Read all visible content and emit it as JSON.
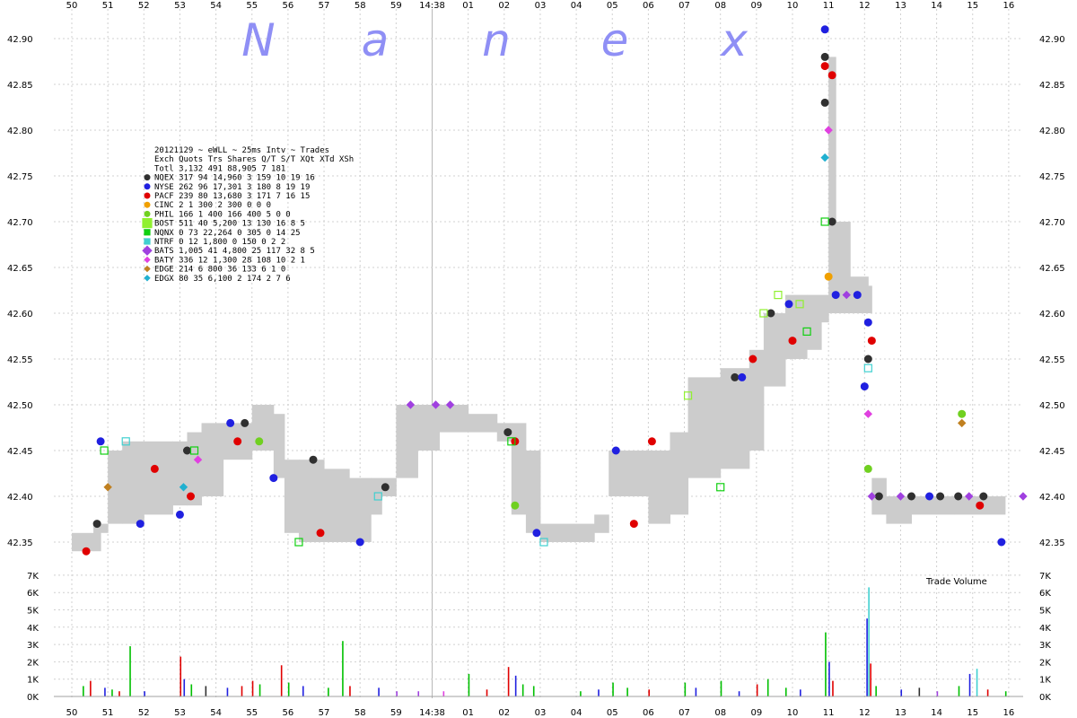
{
  "watermark": [
    "N",
    "a",
    "n",
    "e",
    "x"
  ],
  "legend": {
    "title": "20121129 ~ eWLL ~ 25ms Intv ~ Trades",
    "header": "Exch Quots Trs Shares  Q/T   S/T  XQt XTd XSh",
    "rows": [
      {
        "text": "Totl 3,132 491 88,905    7   181",
        "marker": "",
        "color": ""
      },
      {
        "text": "NQEX   317  94 14,960    3   159  10  19  16",
        "marker": "circle",
        "color": "#303030"
      },
      {
        "text": "NYSE   262  96 17,301    3   180   8  19  19",
        "marker": "circle",
        "color": "#2020e0"
      },
      {
        "text": "PACF   239  80 13,680    3   171   7  16  15",
        "marker": "circle",
        "color": "#e00000"
      },
      {
        "text": "CINC     2   1    300    2   300   0   0   0",
        "marker": "circle",
        "color": "#f0a000"
      },
      {
        "text": "PHIL   166   1    400  166   400   5   0   0",
        "marker": "circle",
        "color": "#70d020"
      },
      {
        "text": "BOST   511  40  5,200   13   130  16   8   5",
        "marker": "square",
        "color": "#90f030"
      },
      {
        "text": "NQNX     0  73 22,264    0   305   0  14  25",
        "marker": "square",
        "color": "#10d010"
      },
      {
        "text": "NTRF     0  12  1,800    0   150   0   2   2",
        "marker": "square",
        "color": "#40d0d0"
      },
      {
        "text": "BATS 1,005  41  4,800   25   117  32   8   5",
        "marker": "diamond",
        "color": "#a040e0"
      },
      {
        "text": "BATY   336  12  1,300   28   108  10   2   1",
        "marker": "diamond",
        "color": "#e040e0"
      },
      {
        "text": "EDGE   214   6    800   36   133   6   1   0",
        "marker": "diamond",
        "color": "#c08020"
      },
      {
        "text": "EDGX    80  35  6,100    2   174   2   7   6",
        "marker": "diamond",
        "color": "#20b0d0"
      }
    ]
  },
  "chart_data": {
    "type": "scatter",
    "x_ticks": [
      "50",
      "51",
      "52",
      "53",
      "54",
      "55",
      "56",
      "57",
      "58",
      "59",
      "14:38",
      "01",
      "02",
      "03",
      "04",
      "05",
      "06",
      "07",
      "08",
      "09",
      "10",
      "11",
      "12",
      "13",
      "14",
      "15",
      "16"
    ],
    "price_axis": {
      "ticks": [
        "42.90",
        "42.85",
        "42.80",
        "42.75",
        "42.70",
        "42.65",
        "42.60",
        "42.55",
        "42.50",
        "42.45",
        "42.40",
        "42.35"
      ],
      "range": [
        42.33,
        42.92
      ]
    },
    "volume_axis": {
      "ticks": [
        "7K",
        "6K",
        "5K",
        "4K",
        "3K",
        "2K",
        "1K",
        "0K"
      ],
      "range": [
        0,
        7000
      ],
      "label": "Trade Volume"
    },
    "nbbo_band": [
      [
        50.0,
        42.34,
        42.36
      ],
      [
        50.6,
        42.34,
        42.37
      ],
      [
        50.8,
        42.36,
        42.37
      ],
      [
        51.0,
        42.37,
        42.45
      ],
      [
        51.4,
        42.37,
        42.46
      ],
      [
        52.0,
        42.38,
        42.46
      ],
      [
        52.8,
        42.39,
        42.46
      ],
      [
        53.2,
        42.39,
        42.47
      ],
      [
        53.6,
        42.4,
        42.48
      ],
      [
        54.2,
        42.44,
        42.48
      ],
      [
        55.0,
        42.45,
        42.5
      ],
      [
        55.6,
        42.42,
        42.49
      ],
      [
        55.9,
        42.36,
        42.44
      ],
      [
        56.3,
        42.35,
        42.44
      ],
      [
        57.0,
        42.35,
        42.43
      ],
      [
        57.7,
        42.35,
        42.42
      ],
      [
        58.3,
        42.38,
        42.42
      ],
      [
        58.6,
        42.4,
        42.42
      ],
      [
        59.0,
        42.42,
        42.5
      ],
      [
        59.6,
        42.45,
        42.5
      ],
      [
        60.2,
        42.47,
        42.5
      ],
      [
        61.0,
        42.47,
        42.49
      ],
      [
        61.8,
        42.46,
        42.48
      ],
      [
        62.2,
        42.38,
        42.48
      ],
      [
        62.6,
        42.36,
        42.45
      ],
      [
        63.0,
        42.35,
        42.37
      ],
      [
        64.0,
        42.35,
        42.37
      ],
      [
        64.5,
        42.36,
        42.38
      ],
      [
        64.9,
        42.4,
        42.45
      ],
      [
        66.0,
        42.37,
        42.45
      ],
      [
        66.6,
        42.38,
        42.47
      ],
      [
        67.1,
        42.42,
        42.53
      ],
      [
        68.0,
        42.43,
        42.54
      ],
      [
        68.8,
        42.45,
        42.56
      ],
      [
        69.2,
        42.52,
        42.6
      ],
      [
        69.8,
        42.55,
        42.62
      ],
      [
        70.4,
        42.56,
        42.62
      ],
      [
        70.8,
        42.59,
        42.62
      ],
      [
        71.0,
        42.6,
        42.88
      ],
      [
        71.2,
        42.6,
        42.7
      ],
      [
        71.6,
        42.6,
        42.64
      ],
      [
        72.1,
        42.6,
        42.63
      ],
      [
        72.2,
        42.38,
        42.42
      ],
      [
        72.6,
        42.37,
        42.4
      ],
      [
        73.3,
        42.38,
        42.4
      ],
      [
        74.5,
        42.38,
        42.4
      ],
      [
        75.3,
        42.38,
        42.4
      ],
      [
        75.9,
        42.37,
        42.4
      ]
    ],
    "series": [
      {
        "name": "NQEX",
        "marker": "circle",
        "color": "#303030",
        "points": [
          [
            50.7,
            42.37
          ],
          [
            53.2,
            42.45
          ],
          [
            54.8,
            42.48
          ],
          [
            56.7,
            42.44
          ],
          [
            58.7,
            42.41
          ],
          [
            62.1,
            42.47
          ],
          [
            68.4,
            42.53
          ],
          [
            69.4,
            42.6
          ],
          [
            70.9,
            42.88
          ],
          [
            70.9,
            42.83
          ],
          [
            71.1,
            42.7
          ],
          [
            72.1,
            42.55
          ],
          [
            72.4,
            42.4
          ],
          [
            73.3,
            42.4
          ],
          [
            74.1,
            42.4
          ],
          [
            74.6,
            42.4
          ],
          [
            75.3,
            42.4
          ]
        ]
      },
      {
        "name": "NYSE",
        "marker": "circle",
        "color": "#2020e0",
        "points": [
          [
            50.8,
            42.46
          ],
          [
            51.9,
            42.37
          ],
          [
            53.0,
            42.38
          ],
          [
            54.4,
            42.48
          ],
          [
            55.6,
            42.42
          ],
          [
            58.0,
            42.35
          ],
          [
            62.9,
            42.36
          ],
          [
            65.1,
            42.45
          ],
          [
            68.6,
            42.53
          ],
          [
            69.9,
            42.61
          ],
          [
            70.9,
            42.91
          ],
          [
            71.2,
            42.62
          ],
          [
            71.8,
            42.62
          ],
          [
            72.1,
            42.59
          ],
          [
            72.0,
            42.52
          ],
          [
            73.8,
            42.4
          ],
          [
            75.8,
            42.35
          ]
        ]
      },
      {
        "name": "PACF",
        "marker": "circle",
        "color": "#e00000",
        "points": [
          [
            50.4,
            42.34
          ],
          [
            52.3,
            42.43
          ],
          [
            53.3,
            42.4
          ],
          [
            54.6,
            42.46
          ],
          [
            56.9,
            42.36
          ],
          [
            62.3,
            42.46
          ],
          [
            65.6,
            42.37
          ],
          [
            66.1,
            42.46
          ],
          [
            68.9,
            42.55
          ],
          [
            70.0,
            42.57
          ],
          [
            70.9,
            42.87
          ],
          [
            71.1,
            42.86
          ],
          [
            72.2,
            42.57
          ],
          [
            75.2,
            42.39
          ]
        ]
      },
      {
        "name": "CINC",
        "marker": "circle",
        "color": "#f0a000",
        "points": [
          [
            71.0,
            42.64
          ]
        ]
      },
      {
        "name": "PHIL",
        "marker": "circle",
        "color": "#70d020",
        "points": [
          [
            55.2,
            42.46
          ],
          [
            62.3,
            42.39
          ],
          [
            72.1,
            42.43
          ],
          [
            74.7,
            42.49
          ]
        ]
      },
      {
        "name": "BOST",
        "marker": "square",
        "color": "#90f030",
        "points": [
          [
            69.2,
            42.6
          ],
          [
            69.6,
            42.62
          ],
          [
            70.2,
            42.61
          ],
          [
            67.1,
            42.51
          ]
        ]
      },
      {
        "name": "NQNX",
        "marker": "square",
        "color": "#10d010",
        "points": [
          [
            50.9,
            42.45
          ],
          [
            53.4,
            42.45
          ],
          [
            56.3,
            42.35
          ],
          [
            62.2,
            42.46
          ],
          [
            68.0,
            42.41
          ],
          [
            70.4,
            42.58
          ],
          [
            70.9,
            42.7
          ]
        ]
      },
      {
        "name": "NTRF",
        "marker": "square",
        "color": "#40d0d0",
        "points": [
          [
            51.5,
            42.46
          ],
          [
            58.5,
            42.4
          ],
          [
            63.1,
            42.35
          ],
          [
            72.1,
            42.54
          ]
        ]
      },
      {
        "name": "BATS",
        "marker": "diamond",
        "color": "#a040e0",
        "points": [
          [
            59.4,
            42.5
          ],
          [
            60.1,
            42.5
          ],
          [
            60.5,
            42.5
          ],
          [
            71.5,
            42.62
          ],
          [
            72.2,
            42.4
          ],
          [
            73.0,
            42.4
          ],
          [
            74.9,
            42.4
          ],
          [
            76.4,
            42.4
          ]
        ]
      },
      {
        "name": "BATY",
        "marker": "diamond",
        "color": "#e040e0",
        "points": [
          [
            53.5,
            42.44
          ],
          [
            71.0,
            42.8
          ],
          [
            72.1,
            42.49
          ]
        ]
      },
      {
        "name": "EDGE",
        "marker": "diamond",
        "color": "#c08020",
        "points": [
          [
            51.0,
            42.41
          ],
          [
            74.7,
            42.48
          ]
        ]
      },
      {
        "name": "EDGX",
        "marker": "diamond",
        "color": "#20b0d0",
        "points": [
          [
            53.1,
            42.41
          ],
          [
            70.9,
            42.77
          ]
        ]
      }
    ],
    "volume_bars": [
      [
        50.3,
        600,
        "#00c000"
      ],
      [
        50.5,
        900,
        "#e00000"
      ],
      [
        50.9,
        500,
        "#2020e0"
      ],
      [
        51.1,
        400,
        "#00c000"
      ],
      [
        51.3,
        300,
        "#e00000"
      ],
      [
        51.6,
        2900,
        "#00c000"
      ],
      [
        52.0,
        300,
        "#2020e0"
      ],
      [
        53.0,
        2300,
        "#e00000"
      ],
      [
        53.1,
        1000,
        "#2020e0"
      ],
      [
        53.3,
        700,
        "#00c000"
      ],
      [
        53.7,
        600,
        "#303030"
      ],
      [
        54.3,
        500,
        "#2020e0"
      ],
      [
        54.7,
        600,
        "#e00000"
      ],
      [
        55.0,
        900,
        "#e00000"
      ],
      [
        55.2,
        700,
        "#00c000"
      ],
      [
        55.8,
        1800,
        "#e00000"
      ],
      [
        56.0,
        800,
        "#00c000"
      ],
      [
        56.4,
        600,
        "#2020e0"
      ],
      [
        57.1,
        500,
        "#00c000"
      ],
      [
        57.5,
        3200,
        "#00c000"
      ],
      [
        57.7,
        600,
        "#e00000"
      ],
      [
        58.5,
        500,
        "#2020e0"
      ],
      [
        59.0,
        300,
        "#a040e0"
      ],
      [
        59.6,
        300,
        "#a040e0"
      ],
      [
        60.3,
        300,
        "#e040e0"
      ],
      [
        61.0,
        1300,
        "#00c000"
      ],
      [
        61.5,
        400,
        "#e00000"
      ],
      [
        62.1,
        1700,
        "#e00000"
      ],
      [
        62.3,
        1200,
        "#2020e0"
      ],
      [
        62.5,
        700,
        "#00c000"
      ],
      [
        62.8,
        600,
        "#00c000"
      ],
      [
        64.1,
        300,
        "#00c000"
      ],
      [
        64.6,
        400,
        "#2020e0"
      ],
      [
        65.0,
        800,
        "#00c000"
      ],
      [
        65.4,
        500,
        "#00c000"
      ],
      [
        66.0,
        400,
        "#e00000"
      ],
      [
        67.0,
        800,
        "#00c000"
      ],
      [
        67.3,
        500,
        "#2020e0"
      ],
      [
        68.0,
        900,
        "#00c000"
      ],
      [
        68.5,
        300,
        "#2020e0"
      ],
      [
        69.0,
        700,
        "#e00000"
      ],
      [
        69.3,
        1000,
        "#00c000"
      ],
      [
        69.8,
        500,
        "#00c000"
      ],
      [
        70.2,
        400,
        "#2020e0"
      ],
      [
        70.9,
        3700,
        "#00c000"
      ],
      [
        71.0,
        2000,
        "#2020e0"
      ],
      [
        71.1,
        900,
        "#e00000"
      ],
      [
        72.1,
        6300,
        "#40d0d0"
      ],
      [
        72.05,
        4500,
        "#2020e0"
      ],
      [
        72.15,
        1900,
        "#e00000"
      ],
      [
        72.3,
        600,
        "#00c000"
      ],
      [
        73.0,
        400,
        "#2020e0"
      ],
      [
        73.5,
        500,
        "#303030"
      ],
      [
        74.0,
        300,
        "#a040e0"
      ],
      [
        74.6,
        600,
        "#00c000"
      ],
      [
        74.9,
        1300,
        "#2020e0"
      ],
      [
        75.1,
        1600,
        "#40d0d0"
      ],
      [
        75.4,
        400,
        "#e00000"
      ],
      [
        75.9,
        300,
        "#00c000"
      ]
    ]
  }
}
